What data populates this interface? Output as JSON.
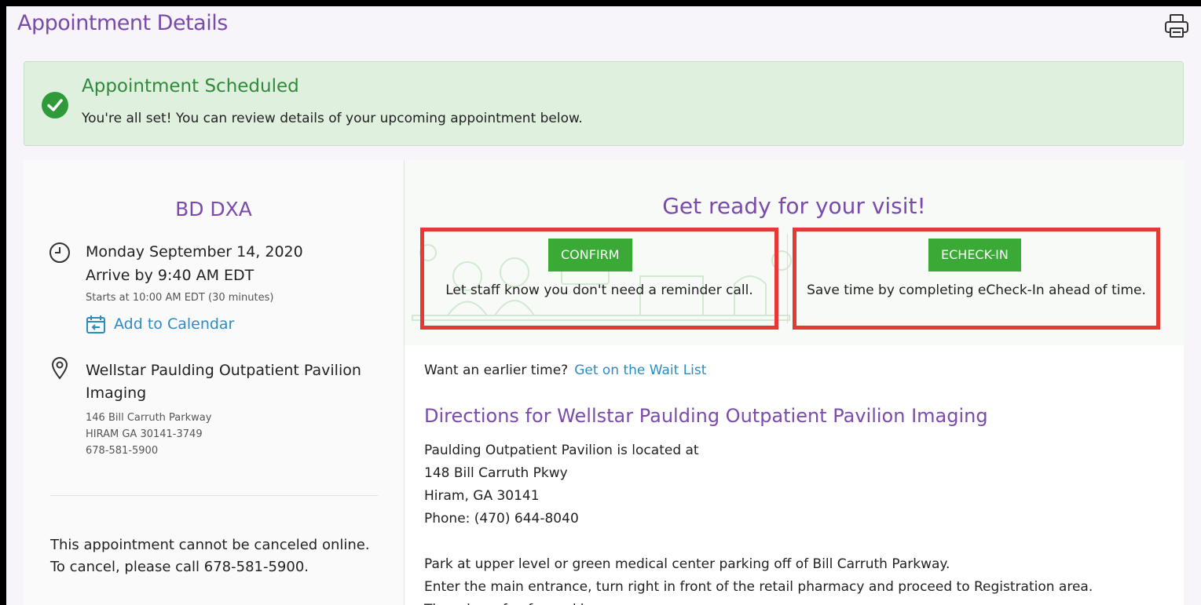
{
  "header": {
    "title": "Appointment Details",
    "print_icon": "printer-icon"
  },
  "banner": {
    "icon": "check-circle-icon",
    "title": "Appointment Scheduled",
    "message": "You're all set! You can review details of your upcoming appointment below.",
    "color": "#2f8a3a"
  },
  "appointment": {
    "name": "BD DXA",
    "date": "Monday September 14, 2020",
    "arrive": "Arrive by 9:40 AM EDT",
    "starts": "Starts at 10:00 AM EDT (30 minutes)",
    "calendar_link": "Add to Calendar",
    "location_name": "Wellstar Paulding Outpatient Pavilion Imaging",
    "address_line1": "146 Bill Carruth Parkway",
    "address_line2": "HIRAM GA 30141-3749",
    "phone": "678-581-5900",
    "cancel_note": "This appointment cannot be canceled online. To cancel, please call 678-581-5900."
  },
  "ready": {
    "title": "Get ready for your visit!",
    "confirm": {
      "button": "CONFIRM",
      "desc": "Let staff know you don't need a reminder call."
    },
    "echeckin": {
      "button": "ECHECK-IN",
      "desc": "Save time by completing eCheck-In ahead of time."
    }
  },
  "waitlist": {
    "prompt": "Want an earlier time?",
    "link": "Get on the Wait List"
  },
  "directions": {
    "title": "Directions for Wellstar Paulding Outpatient Pavilion Imaging",
    "lines": [
      "Paulding Outpatient Pavilion is located at",
      "148 Bill Carruth Pkwy",
      "Hiram, GA 30141",
      "Phone: (470) 644-8040"
    ],
    "parking_lines": [
      "Park at upper level or green medical center parking off of Bill Carruth Parkway.",
      "Enter the main entrance, turn right in front of the retail pharmacy and proceed to Registration area.",
      "There is no fee for parking."
    ]
  },
  "colors": {
    "accent": "#7a4bab",
    "link": "#2b8cc4",
    "button": "#3aa935",
    "highlight": "#e53935"
  }
}
